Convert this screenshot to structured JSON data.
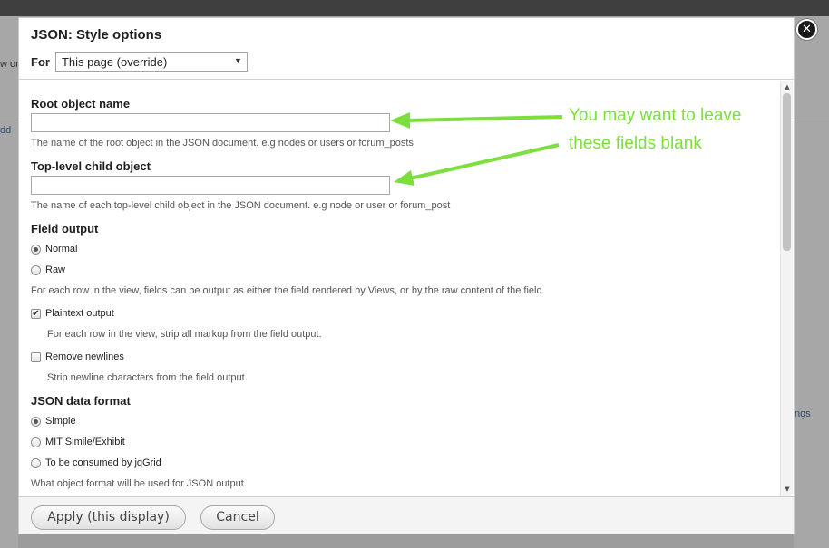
{
  "background": {
    "fragments": [
      "w or",
      "dd",
      "ngs",
      "ngs"
    ]
  },
  "dialog": {
    "title": "JSON: Style options",
    "for_label": "For",
    "for_select_value": "This page (override)",
    "close_glyph": "✕"
  },
  "form": {
    "root_object": {
      "label": "Root object name",
      "value": "",
      "description": "The name of the root object in the JSON document. e.g nodes or users or forum_posts"
    },
    "top_level_child": {
      "label": "Top-level child object",
      "value": "",
      "description": "The name of each top-level child object in the JSON document. e.g node or user or forum_post"
    },
    "field_output": {
      "label": "Field output",
      "options": [
        {
          "label": "Normal",
          "checked": true
        },
        {
          "label": "Raw",
          "checked": false
        }
      ],
      "description": "For each row in the view, fields can be output as either the field rendered by Views, or by the raw content of the field."
    },
    "plaintext_output": {
      "label": "Plaintext output",
      "checked": true,
      "description": "For each row in the view, strip all markup from the field output."
    },
    "remove_newlines": {
      "label": "Remove newlines",
      "checked": false,
      "description": "Strip newline characters from the field output."
    },
    "json_format": {
      "label": "JSON data format",
      "options": [
        {
          "label": "Simple",
          "checked": true
        },
        {
          "label": "MIT Simile/Exhibit",
          "checked": false
        },
        {
          "label": "To be consumed by jqGrid",
          "checked": false
        }
      ],
      "description": "What object format will be used for JSON output."
    }
  },
  "annotation": {
    "line1": "You may want to leave",
    "line2": "these fields blank",
    "color": "#7ddf3e"
  },
  "footer": {
    "apply_label": "Apply (this display)",
    "cancel_label": "Cancel"
  }
}
